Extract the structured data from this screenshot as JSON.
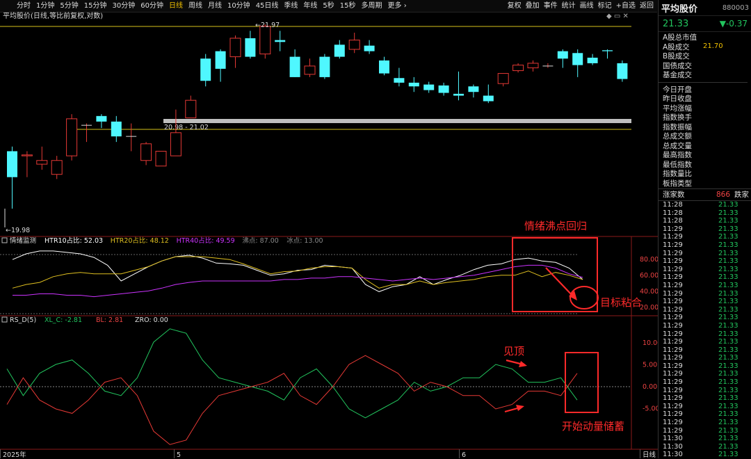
{
  "tabs": [
    "分时",
    "1分钟",
    "5分钟",
    "15分钟",
    "30分钟",
    "60分钟",
    "日线",
    "周线",
    "月线",
    "10分钟",
    "45日线",
    "季线",
    "年线",
    "5秒",
    "15秒",
    "多周期",
    "更多 ›"
  ],
  "active_tab": "日线",
  "toolbar_right": [
    "复权",
    "叠加",
    "事件",
    "统计",
    "画线",
    "标记",
    "+自选",
    "返回"
  ],
  "chart_title": "平均股价(日线,等比前复权,对数)",
  "sidebar": {
    "name": "平均股价",
    "code": "880003",
    "price": "21.33",
    "change": "▼-0.37",
    "items_a": [
      "A股总市值",
      "A股成交",
      "B股成交",
      "国债成交",
      "基金成交"
    ],
    "items_b": [
      "今日开盘",
      "昨日收盘",
      "平均涨幅",
      "指数换手",
      "指数振幅",
      "总成交额",
      "总成交量",
      "最高指数",
      "最低指数",
      "指数量比",
      "板指类型"
    ],
    "zhangjia_label": "涨家数",
    "zhangjia_value": "866",
    "diejia_label": "跌家",
    "val_2170": "21.70",
    "ticks": [
      [
        "11:28",
        "21.33"
      ],
      [
        "11:28",
        "21.33"
      ],
      [
        "11:28",
        "21.33"
      ],
      [
        "11:29",
        "21.33"
      ],
      [
        "11:29",
        "21.33"
      ],
      [
        "11:29",
        "21.33"
      ],
      [
        "11:29",
        "21.33"
      ],
      [
        "11:29",
        "21.33"
      ],
      [
        "11:29",
        "21.33"
      ],
      [
        "11:29",
        "21.33"
      ],
      [
        "11:29",
        "21.33"
      ],
      [
        "11:29",
        "21.33"
      ],
      [
        "11:29",
        "21.33"
      ],
      [
        "11:29",
        "21.33"
      ],
      [
        "11:29",
        "21.33"
      ],
      [
        "11:29",
        "21.33"
      ],
      [
        "11:29",
        "21.33"
      ],
      [
        "11:29",
        "21.33"
      ],
      [
        "11:29",
        "21.33"
      ],
      [
        "11:29",
        "21.33"
      ],
      [
        "11:29",
        "21.33"
      ],
      [
        "11:29",
        "21.33"
      ],
      [
        "11:29",
        "21.33"
      ],
      [
        "11:29",
        "21.33"
      ],
      [
        "11:29",
        "21.33"
      ],
      [
        "11:29",
        "21.33"
      ],
      [
        "11:29",
        "21.33"
      ],
      [
        "11:29",
        "21.33"
      ],
      [
        "11:29",
        "21.33"
      ],
      [
        "11:30",
        "21.33"
      ],
      [
        "11:30",
        "21.33"
      ],
      [
        "11:30",
        "21.33"
      ]
    ]
  },
  "price_labels": {
    "high": "21.97",
    "low": "19.98",
    "zone": "20.98 - 21.02"
  },
  "panel2": {
    "legend": [
      [
        "情绪监测",
        "#dddddd"
      ],
      [
        "HTR10占比: 52.03",
        "#ffffff"
      ],
      [
        "HTR20占比: 48.12",
        "#e0c020"
      ],
      [
        "HTR40占比: 49.59",
        "#cc33ff"
      ],
      [
        "沸点: 87.00",
        "#888888"
      ],
      [
        "冰点: 13.00",
        "#888888"
      ]
    ],
    "ticks": [
      "80.00",
      "60.00",
      "40.00",
      "20.00"
    ]
  },
  "panel3": {
    "legend": [
      [
        "RS_D(5)",
        "#dddddd"
      ],
      [
        "XL_C: -2.81",
        "#22c55e"
      ],
      [
        "BL: 2.81",
        "#ef4444"
      ],
      [
        "ZRO: 0.00",
        "#dddddd"
      ]
    ],
    "ticks": [
      "10.00",
      "5.00",
      "0.00",
      "-5.00"
    ]
  },
  "xaxis": [
    [
      "2025年",
      0
    ],
    [
      "5",
      250
    ],
    [
      "6",
      660
    ],
    [
      "日线",
      920
    ]
  ],
  "annotations": {
    "a1": "情绪沸点回归",
    "a2": "目标粘合",
    "a3": "见顶",
    "a4": "开始动量储蓄"
  },
  "chart_data": {
    "type": "candlestick",
    "candles": [
      [
        20.6,
        20.32,
        20.65,
        19.98
      ],
      [
        20.55,
        20.56,
        20.6,
        20.32
      ],
      [
        20.46,
        20.5,
        20.65,
        20.4
      ],
      [
        20.35,
        20.5,
        20.55,
        20.3
      ],
      [
        20.55,
        20.95,
        21.0,
        20.5
      ],
      [
        20.88,
        20.88,
        20.9,
        20.7
      ],
      [
        20.98,
        20.92,
        21.0,
        20.85
      ],
      [
        20.92,
        20.76,
        20.98,
        20.7
      ],
      [
        20.76,
        20.76,
        20.9,
        20.6
      ],
      [
        20.5,
        20.68,
        20.7,
        20.45
      ],
      [
        20.44,
        20.6,
        20.6,
        20.45
      ],
      [
        20.55,
        20.8,
        21.05,
        20.55
      ],
      [
        20.96,
        21.15,
        21.2,
        20.96
      ],
      [
        21.6,
        21.36,
        21.65,
        21.3
      ],
      [
        21.68,
        21.49,
        21.7,
        21.35
      ],
      [
        21.62,
        21.82,
        21.85,
        21.5
      ],
      [
        21.82,
        21.62,
        21.9,
        21.6
      ],
      [
        21.65,
        21.95,
        21.97,
        21.6
      ],
      [
        21.8,
        21.78,
        21.9,
        21.68
      ],
      [
        21.62,
        21.4,
        21.7,
        21.4
      ],
      [
        21.43,
        21.52,
        21.6,
        21.4
      ],
      [
        21.62,
        21.4,
        21.65,
        21.38
      ],
      [
        21.75,
        21.62,
        21.8,
        21.6
      ],
      [
        21.7,
        21.8,
        21.88,
        21.66
      ],
      [
        21.74,
        21.68,
        21.8,
        21.65
      ],
      [
        21.58,
        21.44,
        21.62,
        21.42
      ],
      [
        21.39,
        21.34,
        21.5,
        21.3
      ],
      [
        21.34,
        21.3,
        21.4,
        21.24
      ],
      [
        21.32,
        21.26,
        21.35,
        21.23
      ],
      [
        21.31,
        21.23,
        21.34,
        21.2
      ],
      [
        21.22,
        21.2,
        21.46,
        21.15
      ],
      [
        21.3,
        21.24,
        21.32,
        21.18
      ],
      [
        21.2,
        21.14,
        21.32,
        21.12
      ],
      [
        21.33,
        21.44,
        21.44,
        21.3
      ],
      [
        21.47,
        21.53,
        21.55,
        21.45
      ],
      [
        21.5,
        21.55,
        21.58,
        21.46
      ],
      [
        21.52,
        21.52,
        21.55,
        21.5
      ],
      [
        21.68,
        21.6,
        21.7,
        21.5
      ],
      [
        21.66,
        21.53,
        21.7,
        21.4
      ],
      [
        21.61,
        21.55,
        21.65,
        21.53
      ],
      [
        21.69,
        21.68,
        21.7,
        21.6
      ],
      [
        21.55,
        21.38,
        21.58,
        21.35
      ]
    ],
    "series": [
      {
        "name": "HTR10占比",
        "values": [
          80,
          88,
          92,
          92,
          90,
          88,
          83,
          72,
          50,
          60,
          70,
          78,
          84,
          86,
          82,
          75,
          74,
          72,
          65,
          58,
          60,
          65,
          66,
          72,
          70,
          68,
          45,
          35,
          42,
          45,
          56,
          45,
          52,
          58,
          66,
          72,
          74,
          80,
          82,
          78,
          76,
          68,
          52
        ]
      },
      {
        "name": "HTR20占比",
        "values": [
          40,
          45,
          48,
          56,
          60,
          62,
          60,
          60,
          60,
          65,
          70,
          78,
          84,
          84,
          84,
          82,
          80,
          74,
          67,
          60,
          63,
          64,
          68,
          70,
          70,
          68,
          52,
          40,
          45,
          45,
          50,
          45,
          48,
          50,
          52,
          56,
          58,
          58,
          64,
          56,
          62,
          58,
          52
        ]
      },
      {
        "name": "HTR40占比",
        "values": [
          30,
          30,
          32,
          32,
          30,
          30,
          28,
          30,
          32,
          34,
          36,
          40,
          45,
          48,
          50,
          50,
          50,
          50,
          50,
          50,
          52,
          52,
          54,
          54,
          56,
          56,
          54,
          52,
          50,
          52,
          54,
          52,
          54,
          56,
          58,
          62,
          66,
          70,
          72,
          72,
          68,
          60,
          55
        ]
      },
      {
        "name": "XL_C",
        "values": [
          4,
          -2,
          3,
          5,
          6,
          3,
          -1,
          -2,
          2,
          10,
          13,
          12,
          6,
          2,
          1,
          0,
          -1,
          -3,
          2,
          4,
          0,
          -5,
          -7,
          -5,
          -3,
          1,
          -1,
          0,
          2,
          2,
          5,
          4,
          1,
          1,
          2,
          -3
        ]
      },
      {
        "name": "BL",
        "values": [
          -4,
          2,
          -3,
          -5,
          -6,
          -3,
          1,
          2,
          -2,
          -10,
          -13,
          -12,
          -6,
          -2,
          -1,
          0,
          1,
          3,
          -2,
          -4,
          0,
          5,
          7,
          5,
          3,
          -1,
          1,
          0,
          -2,
          -2,
          -5,
          -4,
          -1,
          -1,
          -2,
          3
        ]
      }
    ]
  }
}
